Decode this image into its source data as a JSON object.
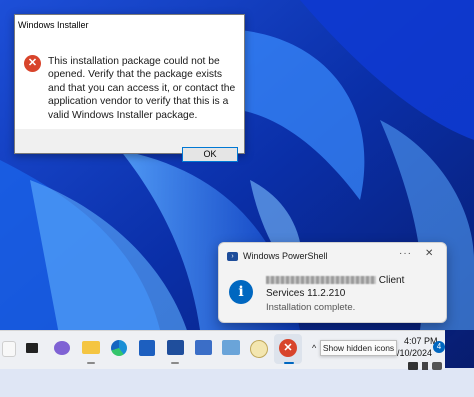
{
  "installer_dialog": {
    "title": "Windows Installer",
    "icon": "error-icon",
    "message": "This installation package could not be opened.  Verify that the package exists and that you can access it, or contact the application vendor to verify that this is a valid Windows Installer package.",
    "ok_label": "OK"
  },
  "toast": {
    "app_name": "Windows PowerShell",
    "title_suffix": "Client Services 11.2.210",
    "body": "Installation complete.",
    "more_glyph": "···",
    "close_glyph": "✕",
    "info_glyph": "i"
  },
  "taskbar": {
    "items": [
      "start-icon",
      "tv-icon",
      "chat-icon",
      "folder-icon",
      "edge-icon",
      "store-icon",
      "powershell-icon",
      "powershell-ise-icon",
      "remote-desktop-icon",
      "clock-app-icon",
      "installer-error-icon"
    ],
    "tooltip": "Show hidden icons",
    "chevron": "^",
    "time": "4:07 PM",
    "date": "5/10/2024",
    "notification_count": "4"
  },
  "colors": {
    "error": "#d8442b",
    "info": "#0067c0",
    "accent": "#0078d4"
  }
}
